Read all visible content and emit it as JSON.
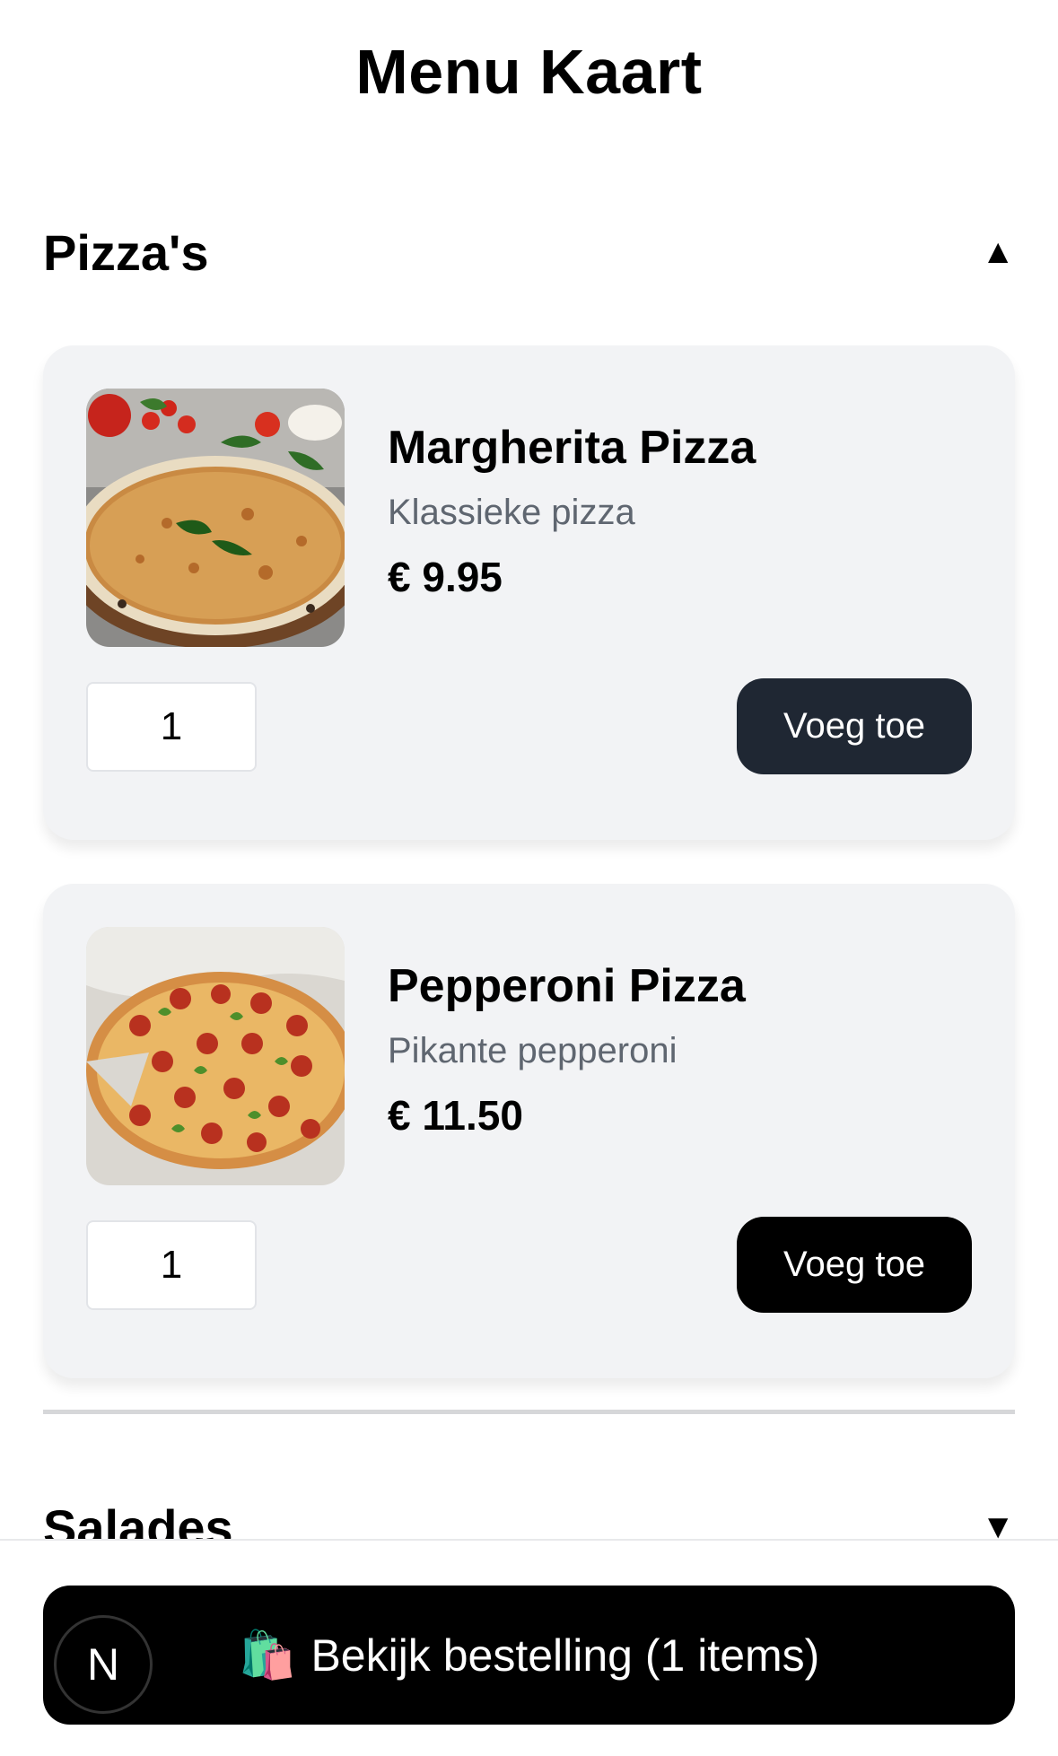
{
  "page_title": "Menu Kaart",
  "sections": [
    {
      "title": "Pizza's",
      "caret": "▲",
      "items": [
        {
          "name": "Margherita Pizza",
          "description": "Klassieke pizza",
          "price": "€ 9.95",
          "quantity": "1",
          "add_label": "Voeg toe",
          "button_color": "#1f2733",
          "image": "margherita-pizza-photo"
        },
        {
          "name": "Pepperoni Pizza",
          "description": "Pikante pepperoni",
          "price": "€ 11.50",
          "quantity": "1",
          "add_label": "Voeg toe",
          "button_color": "#000000",
          "image": "pepperoni-pizza-photo"
        }
      ]
    },
    {
      "title": "Salades",
      "caret": "▼"
    }
  ],
  "order_bar": {
    "icon": "🛍️",
    "label": "Bekijk bestelling (1 items)",
    "badge": "N"
  }
}
